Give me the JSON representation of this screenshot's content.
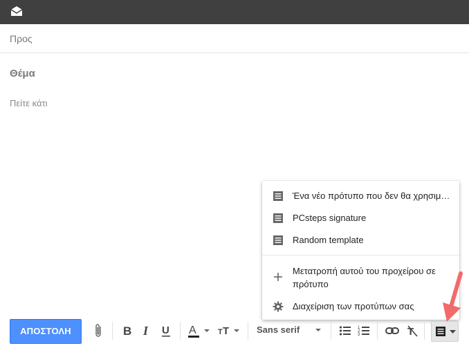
{
  "compose": {
    "to_label": "Προς",
    "subject_placeholder": "Θέμα",
    "body_placeholder": "Πείτε κάτι"
  },
  "templates_menu": {
    "items": [
      {
        "label": "Ένα νέο πρότυπο που δεν θα χρησιμ…",
        "icon": "template-doc-icon"
      },
      {
        "label": "PCsteps signature",
        "icon": "template-doc-icon"
      },
      {
        "label": "Random template",
        "icon": "template-doc-icon"
      }
    ],
    "save_as_template": {
      "label": "Μετατροπή αυτού του προχείρου σε πρότυπο",
      "icon": "plus-icon"
    },
    "manage_templates": {
      "label": "Διαχείριση των προτύπων σας",
      "icon": "gear-icon"
    }
  },
  "toolbar": {
    "send_label": "ΑΠΟΣΤΟΛΗ",
    "font_family": "Sans serif"
  },
  "colors": {
    "topbar": "#404040",
    "send_button": "#4d90fe",
    "arrow": "#f26b6b"
  }
}
